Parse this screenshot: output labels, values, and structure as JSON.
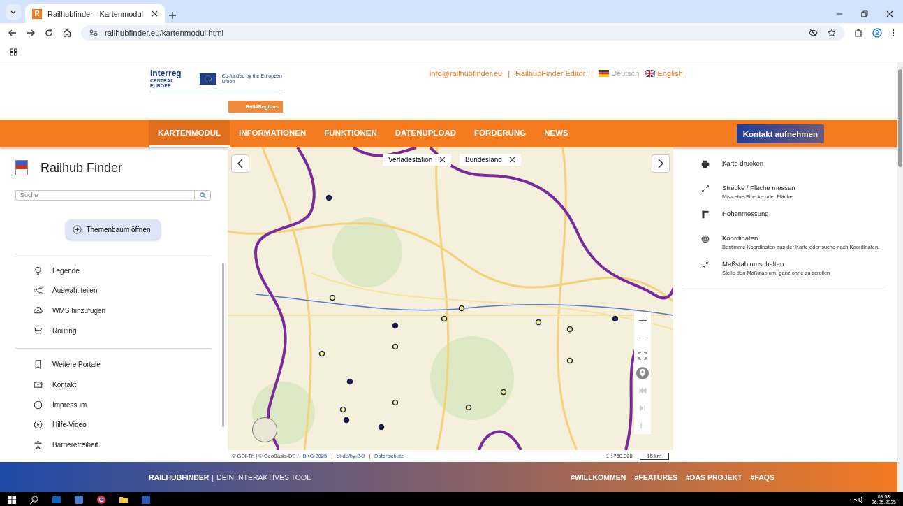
{
  "browser": {
    "tab_title": "Railhubfinder - Kartenmodul",
    "favicon": "R",
    "url": "railhubfinder.eu/kartenmodul.html"
  },
  "header": {
    "logo_title": "Interreg",
    "logo_subtitle": "CENTRAL EUROPE",
    "eu_text": "Co-funded by the European Union",
    "project_badge": "Rail4Regions",
    "links": [
      "info@railhubfinder.eu",
      "RailhubFinder Editor"
    ],
    "separator": "|",
    "languages": [
      {
        "label": "Deutsch",
        "selected": false
      },
      {
        "label": "English",
        "selected": true
      }
    ]
  },
  "nav": {
    "items": [
      {
        "label": "KARTENMODUL",
        "selected": true
      },
      {
        "label": "INFORMATIONEN",
        "selected": false
      },
      {
        "label": "FUNKTIONEN",
        "selected": false
      },
      {
        "label": "DATENUPLOAD",
        "selected": false
      },
      {
        "label": "FÖRDERUNG",
        "selected": false
      },
      {
        "label": "NEWS",
        "selected": false
      }
    ],
    "cta": "Kontakt aufnehmen"
  },
  "sidebar": {
    "title": "Railhub Finder",
    "search_placeholder": "Suche",
    "theme_button": "Themenbaum öffnen",
    "groups": [
      [
        "Legende",
        "Auswahl teilen",
        "WMS hinzufügen",
        "Routing"
      ],
      [
        "Weitere Portale",
        "Kontakt",
        "Impressum",
        "Hilfe-Video",
        "Barrierefreiheit"
      ]
    ]
  },
  "map": {
    "filters": [
      "Verladestation",
      "Bundesland"
    ],
    "attribution_source": "© GDI-Th | © GeoBasis-DE /",
    "attribution_links": [
      "BKG 2025",
      "dl-de/by-2-0",
      "Datenschutz"
    ],
    "separator": "|",
    "scale_ratio": "1 : 750.000",
    "scale_bar": "15 km"
  },
  "tools": [
    {
      "title": "Karte drucken"
    },
    {
      "title": "Strecke / Fläche messen",
      "description": "Miss eine Strecke oder Fläche"
    },
    {
      "title": "Höhenmessung"
    },
    {
      "title": "Koordinaten",
      "description": "Bestimme Koordinaten aus der Karte oder suche nach Koordinaten."
    },
    {
      "title": "Maßstab umschalten",
      "description": "Stelle den Maßstab um, ganz ohne zu scrollen"
    }
  ],
  "footer": {
    "brand": "RAILHUBFINDER",
    "separator": "|",
    "tagline": "DEIN INTERAKTIVES TOOL",
    "links": [
      "#WILLKOMMEN",
      "#FEATURES",
      "#DAS PROJEKT",
      "#FAQS"
    ]
  },
  "taskbar": {
    "time": "09:58",
    "date": "26.05.2025"
  }
}
